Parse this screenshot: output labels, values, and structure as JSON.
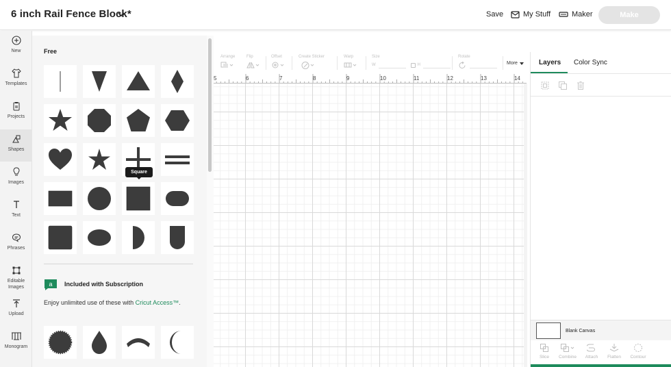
{
  "header": {
    "title": "6 inch Rail Fence Block*",
    "save_label": "Save",
    "mystuff_label": "My Stuff",
    "maker_label": "Maker",
    "make_label": "Make"
  },
  "left_tools": [
    {
      "label": "New",
      "icon": "plus-circle-icon"
    },
    {
      "label": "Templates",
      "icon": "shirt-icon"
    },
    {
      "label": "Projects",
      "icon": "clipboard-icon"
    },
    {
      "label": "Shapes",
      "icon": "shapes-icon",
      "active": true
    },
    {
      "label": "Images",
      "icon": "bulb-icon"
    },
    {
      "label": "Text",
      "icon": "text-icon"
    },
    {
      "label": "Phrases",
      "icon": "speech-bubble-icon"
    },
    {
      "label": "Editable Images",
      "icon": "editable-image-icon"
    },
    {
      "label": "Upload",
      "icon": "upload-icon"
    },
    {
      "label": "Monogram",
      "icon": "monogram-icon"
    }
  ],
  "shapes_panel": {
    "free_heading": "Free",
    "free_shapes": [
      "line",
      "triangle-down",
      "triangle",
      "diamond",
      "star",
      "octagon",
      "pentagon",
      "hexagon",
      "heart",
      "star-thin",
      "cross",
      "equals",
      "rectangle",
      "circle",
      "square",
      "rounded-rectangle",
      "rounded-square",
      "oval",
      "half-circle",
      "u-shape"
    ],
    "tooltip": "Square",
    "subscription_heading": "Included with Subscription",
    "subscription_text": "Enjoy unlimited use of these with ",
    "subscription_link": "Cricut Access™",
    "subscription_text_end": ".",
    "subscription_shapes": [
      "scalloped-circle",
      "drop",
      "arc",
      "crescent"
    ]
  },
  "edit_toolbar": {
    "arrange": "Arrange",
    "flip": "Flip",
    "offset": "Offset",
    "create_sticker": "Create Sticker",
    "warp": "Warp",
    "size": "Size",
    "size_w": "W",
    "size_h": "H",
    "rotate": "Rotate",
    "more": "More"
  },
  "ruler": {
    "numbers": [
      "5",
      "6",
      "7",
      "8",
      "9",
      "10",
      "11",
      "12",
      "13",
      "14"
    ]
  },
  "right_panel": {
    "tab_layers": "Layers",
    "tab_color_sync": "Color Sync",
    "blank_canvas": "Blank Canvas",
    "tools": [
      "Slice",
      "Combine",
      "Attach",
      "Flatten",
      "Contour"
    ]
  },
  "colors": {
    "accent": "#1e8b5c",
    "shape_fill": "#3c3c3c"
  }
}
